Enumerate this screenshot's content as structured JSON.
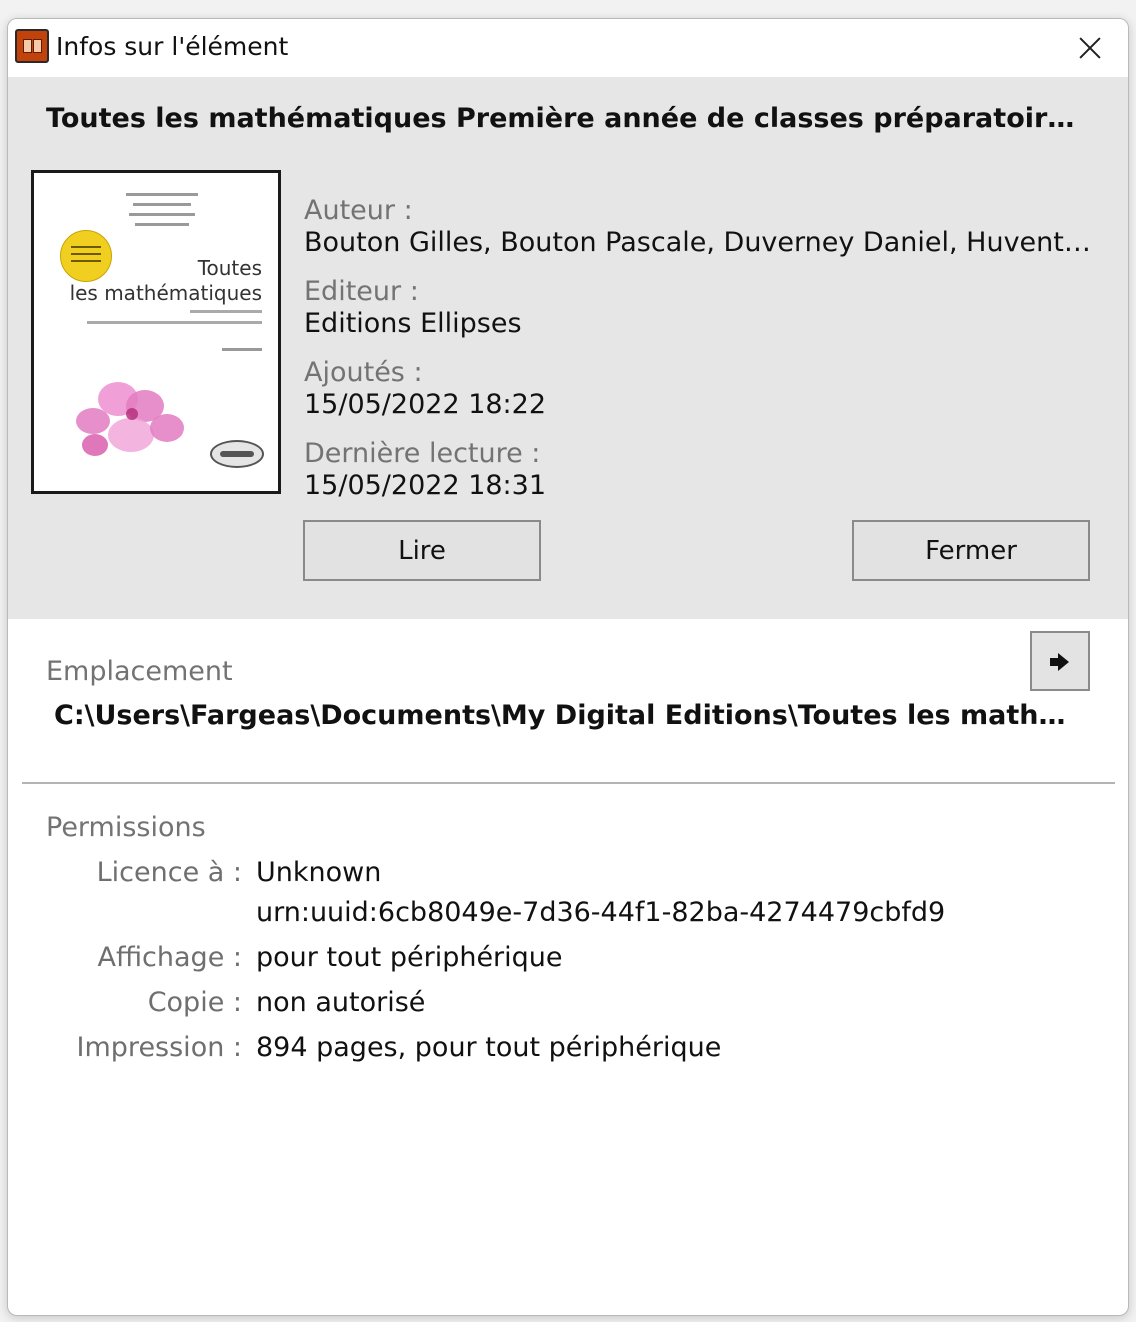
{
  "window": {
    "title": "Infos sur l'élément",
    "app_icon": "digital-editions-icon",
    "close_icon": "close-icon"
  },
  "book": {
    "title": "Toutes les mathématiques Première année de classes préparatoires scie...",
    "cover": {
      "title_line1": "Toutes",
      "title_line2": "les mathématiques"
    },
    "author_label": "Auteur :",
    "author": "Bouton Gilles, Bouton Pascale, Duverney Daniel, Huvent G...",
    "publisher_label": "Editeur :",
    "publisher": "Editions Ellipses",
    "added_label": "Ajoutés :",
    "added": "15/05/2022 18:22",
    "last_read_label": "Dernière lecture :",
    "last_read": "15/05/2022 18:31"
  },
  "actions": {
    "read_label": "Lire",
    "close_label": "Fermer"
  },
  "location": {
    "label": "Emplacement",
    "path": "C:\\Users\\Fargeas\\Documents\\My Digital Editions\\Toutes les mathémat...",
    "reveal_icon": "arrow-right-icon"
  },
  "permissions": {
    "title": "Permissions",
    "license_label": "Licence à :",
    "license_value": "Unknown",
    "license_urn": "urn:uuid:6cb8049e-7d36-44f1-82ba-4274479cbfd9",
    "display_label": "Affichage :",
    "display_value": "pour tout périphérique",
    "copy_label": "Copie :",
    "copy_value": "non autorisé",
    "print_label": "Impression :",
    "print_value": "894 pages, pour tout périphérique"
  },
  "colors": {
    "accent_icon": "#c1420a",
    "panel_bg": "#e6e6e6",
    "label_gray": "#737373"
  }
}
